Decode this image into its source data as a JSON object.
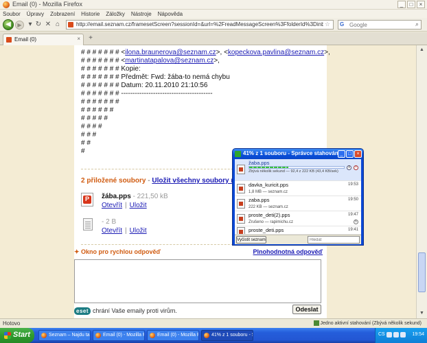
{
  "window": {
    "title": "Email (0) - Mozilla Firefox"
  },
  "menu": [
    "Soubor",
    "Úpravy",
    "Zobrazení",
    "Historie",
    "Záložky",
    "Nástroje",
    "Nápověda"
  ],
  "nav": {
    "url": "http://email.seznam.cz/framesetScreen?sessionId=&url=%2FreadMessageScreen%3FfolderId%3Dinbox%26messageId%3D1112",
    "search_placeholder": "Google"
  },
  "tabs": [
    {
      "label": "Email (0)"
    }
  ],
  "message": {
    "lines": [
      {
        "prefix": "# # # # # # # <",
        "email1": "ilona.braunerova@seznam.cz",
        "mid": ">, <",
        "email2": "kopeckova.pavlina@seznam.cz",
        "suffix": ">,"
      },
      {
        "prefix": "# # # # # # # <",
        "email1": "martinatapalova@seznam.cz",
        "suffix": ">,"
      }
    ],
    "plain_lines": [
      "# # # # # # # Kopie:",
      "# # # # # # # Předmět: Fwd: žába-to nemá chybu",
      "# # # # # # # Datum: 20.11.2010 21:10:56",
      "# # # # # # # ----------------------------------------",
      "# # # # # # #",
      "# # # # # #",
      "# # # # #",
      "# # # #",
      "# # #",
      "# #",
      "#"
    ]
  },
  "attachments": {
    "heading": "2 přiložené soubory",
    "separator": "-",
    "save_all": "Uložit všechny soubory najednou",
    "items": [
      {
        "name": "žába.pps",
        "size": "- 221,50 kB",
        "open": "Otevřít",
        "save": "Uložit"
      },
      {
        "name": "",
        "size": "- 2 B",
        "open": "Otevřít",
        "save": "Uložit"
      }
    ]
  },
  "reply": {
    "heading": "Okno pro rychlou odpověď",
    "full_reply": "Plnohodnotná odpověď",
    "eset_logo": "eset",
    "eset_text": "chrání Vaše emaily proti virům.",
    "send": "Odeslat"
  },
  "status": {
    "left": "Hotovo",
    "right": "Jedno aktivní stahování (Zbývá několik sekund)"
  },
  "downloads": {
    "title": "41% z 1 souboru - Správce stahování",
    "active": {
      "name": "žaba.pps",
      "progress": 41,
      "detail": "Zbývá několik sekund — 92,4 z 222 KB (43,4 KB/sek)"
    },
    "items": [
      {
        "name": "davka_kuricit.pps",
        "detail": "1,8 MB — seznam.cz",
        "time": "19:53"
      },
      {
        "name": "zaba.pps",
        "detail": "222 KB — seznam.cz",
        "time": "19:50"
      },
      {
        "name": "proste_deti(2).pps",
        "detail": "Zrušeno — rapimichu.cz",
        "time": "19:47"
      },
      {
        "name": "proste_deti.pps",
        "detail": "",
        "time": "19:41"
      }
    ],
    "clear": "Vyčistit seznam",
    "search_placeholder": "Hledat"
  },
  "taskbar": {
    "start": "Start",
    "tasks": [
      "Seznam – Najdu tam...",
      "Email (0) - Mozilla Fire...",
      "Email (0) - Mozilla Fire...",
      "41% z 1 souboru - Sp..."
    ],
    "lang": "CS",
    "clock": "19:54"
  }
}
